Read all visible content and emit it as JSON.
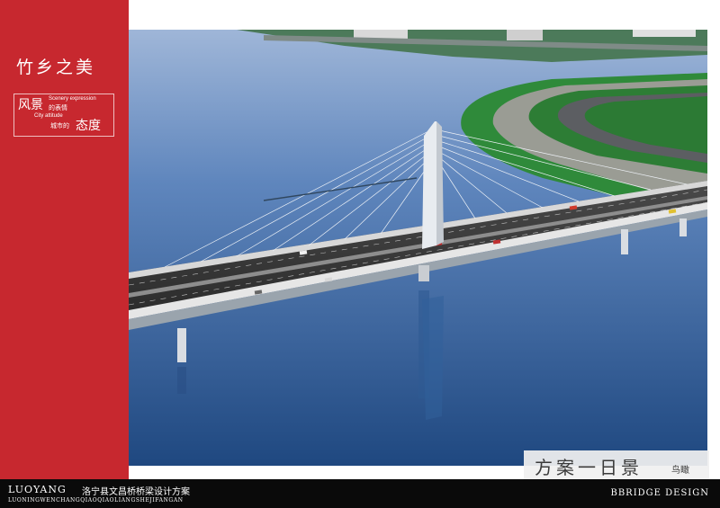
{
  "sidebar": {
    "title": "竹乡之美",
    "motto": {
      "line1_big": "风景",
      "line1_en": "Scenery expression",
      "line1_cn": "的表情",
      "line2_en": "City attitude",
      "line2_cn": "城市的",
      "line2_big": "态度"
    }
  },
  "caption": {
    "main": "方案一日景",
    "sub": "鸟瞰"
  },
  "footer": {
    "city": "LUOYANG",
    "project": "洛宁县文昌桥桥梁设计方案",
    "pinyin": "LUONINGWENCHANGQIAOQIAOLIANGSHEJIFANGAN",
    "brand": "BBRIDGE DESIGN"
  },
  "colors": {
    "sidebar_red": "#c7282f",
    "footer_black": "#0a0a0a",
    "water": "#3f6ea8",
    "grass": "#2f8a3a"
  }
}
